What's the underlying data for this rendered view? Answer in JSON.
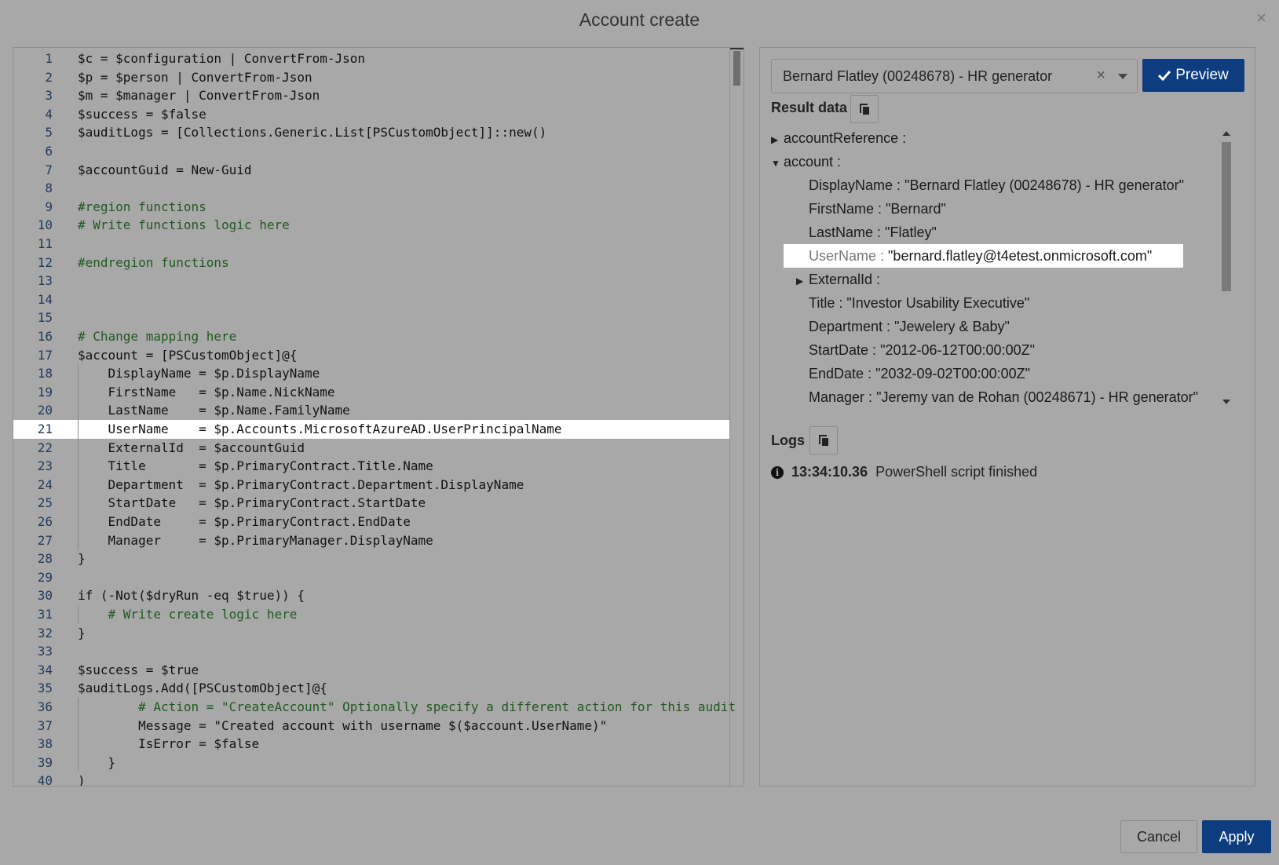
{
  "dialog": {
    "title": "Account create",
    "close_glyph": "×"
  },
  "editor": {
    "highlighted_line": 21,
    "lines": [
      "$c = $configuration | ConvertFrom-Json",
      "$p = $person | ConvertFrom-Json",
      "$m = $manager | ConvertFrom-Json",
      "$success = $false",
      "$auditLogs = [Collections.Generic.List[PSCustomObject]]::new()",
      "",
      "$accountGuid = New-Guid",
      "",
      "#region functions",
      "# Write functions logic here",
      "",
      "#endregion functions",
      "",
      "",
      "",
      "# Change mapping here",
      "$account = [PSCustomObject]@{",
      "    DisplayName = $p.DisplayName",
      "    FirstName   = $p.Name.NickName",
      "    LastName    = $p.Name.FamilyName",
      "    UserName    = $p.Accounts.MicrosoftAzureAD.UserPrincipalName",
      "    ExternalId  = $accountGuid",
      "    Title       = $p.PrimaryContract.Title.Name",
      "    Department  = $p.PrimaryContract.Department.DisplayName",
      "    StartDate   = $p.PrimaryContract.StartDate",
      "    EndDate     = $p.PrimaryContract.EndDate",
      "    Manager     = $p.PrimaryManager.DisplayName",
      "}",
      "",
      "if (-Not($dryRun -eq $true)) {",
      "    # Write create logic here",
      "}",
      "",
      "$success = $true",
      "$auditLogs.Add([PSCustomObject]@{",
      "        # Action = \"CreateAccount\" Optionally specify a different action for this audit",
      "        Message = \"Created account with username $($account.UserName)\"",
      "        IsError = $false",
      "    }",
      ")"
    ]
  },
  "preview": {
    "person_select_value": "Bernard Flatley (00248678) - HR generator",
    "clear_glyph": "×",
    "button_label": "Preview",
    "button_icon": "check-icon"
  },
  "result": {
    "label": "Result data",
    "tree": [
      {
        "indent": 0,
        "arrow": "collapsed",
        "key": "accountReference",
        "sep": " :",
        "value": ""
      },
      {
        "indent": 0,
        "arrow": "expanded",
        "key": "account",
        "sep": " :",
        "value": ""
      },
      {
        "indent": 2,
        "arrow": "",
        "key": "DisplayName",
        "sep": " : ",
        "value": "\"Bernard Flatley (00248678) - HR generator\""
      },
      {
        "indent": 2,
        "arrow": "",
        "key": "FirstName",
        "sep": " : ",
        "value": "\"Bernard\""
      },
      {
        "indent": 2,
        "arrow": "",
        "key": "LastName",
        "sep": " : ",
        "value": "\"Flatley\""
      },
      {
        "indent": 2,
        "arrow": "",
        "key": "UserName",
        "sep": " : ",
        "value": "\"bernard.flatley@t4etest.onmicrosoft.com\"",
        "highlight": true
      },
      {
        "indent": 1,
        "arrow": "collapsed",
        "key": "ExternalId",
        "sep": " :",
        "value": ""
      },
      {
        "indent": 2,
        "arrow": "",
        "key": "Title",
        "sep": " : ",
        "value": "\"Investor Usability Executive\""
      },
      {
        "indent": 2,
        "arrow": "",
        "key": "Department",
        "sep": " : ",
        "value": "\"Jewelery & Baby\""
      },
      {
        "indent": 2,
        "arrow": "",
        "key": "StartDate",
        "sep": " : ",
        "value": "\"2012-06-12T00:00:00Z\""
      },
      {
        "indent": 2,
        "arrow": "",
        "key": "EndDate",
        "sep": " : ",
        "value": "\"2032-09-02T00:00:00Z\""
      },
      {
        "indent": 2,
        "arrow": "",
        "key": "Manager",
        "sep": " : ",
        "value": "\"Jeremy van de Rohan (00248671) - HR generator\""
      }
    ]
  },
  "logs": {
    "label": "Logs",
    "entries": [
      {
        "icon": "info-icon",
        "time": "13:34:10.36",
        "message": "PowerShell script finished"
      }
    ]
  },
  "footer": {
    "cancel_label": "Cancel",
    "apply_label": "Apply"
  },
  "colors": {
    "primary_button": "#0d3d7e",
    "overlay_background": "#a8a8a8",
    "highlight_row": "#ffffff"
  }
}
